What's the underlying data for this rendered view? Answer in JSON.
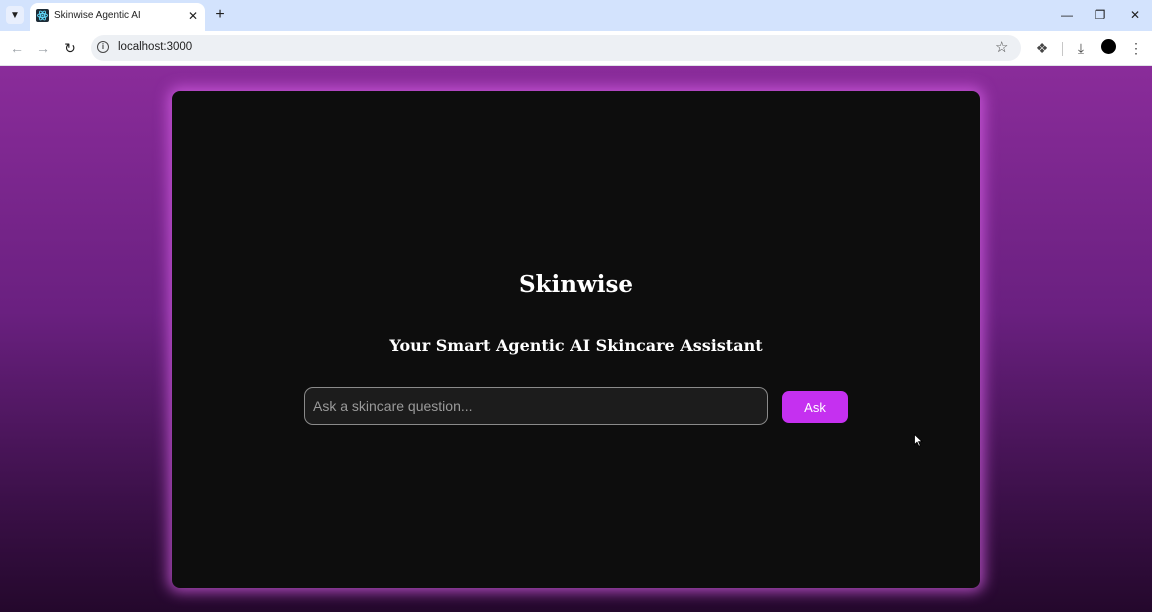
{
  "browser": {
    "tab_title": "Skinwise Agentic AI",
    "url": "localhost:3000"
  },
  "app": {
    "title": "Skinwise",
    "subtitle": "Your Smart Agentic AI Skincare Assistant",
    "input_placeholder": "Ask a skincare question...",
    "input_value": "",
    "ask_label": "Ask"
  },
  "colors": {
    "accent": "#c530f0",
    "card_background": "#0d0d0d",
    "page_gradient_top": "#8a2c9a",
    "page_gradient_bottom": "#24082c"
  }
}
